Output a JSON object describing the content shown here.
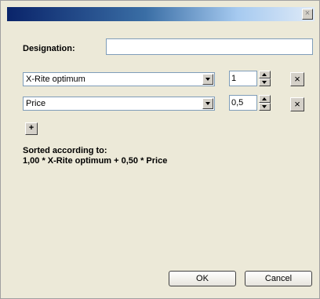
{
  "titlebar": {
    "close_label": "×"
  },
  "designation": {
    "label": "Designation:",
    "value": ""
  },
  "criteria": [
    {
      "name": "X-Rite optimum",
      "weight": "1"
    },
    {
      "name": "Price",
      "weight": "0,5"
    }
  ],
  "remove_label": "×",
  "add_label": "+",
  "sorted": {
    "heading": "Sorted according to:",
    "formula": "1,00 * X-Rite optimum + 0,50 * Price"
  },
  "buttons": {
    "ok": "OK",
    "cancel": "Cancel"
  },
  "colors": {
    "title_start": "#0a246a",
    "title_end": "#dfeaf7",
    "dialog_bg": "#ece9d8"
  }
}
